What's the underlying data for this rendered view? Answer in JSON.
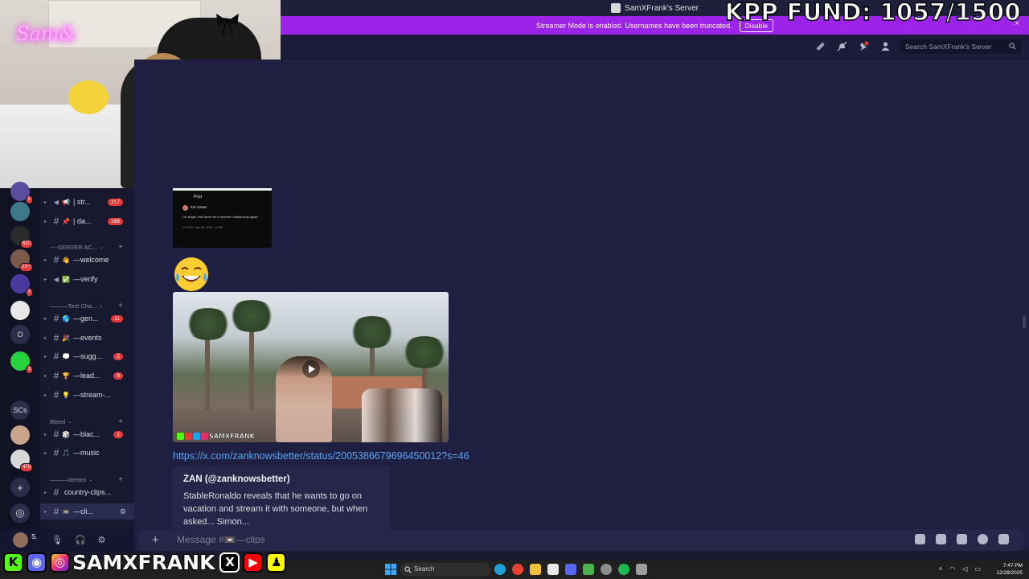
{
  "overlay": {
    "kpp_fund": "KPP FUND: 1057/1500",
    "cam_neon": "Sam&",
    "social_handle": "SAMXFRANK",
    "social_icons": [
      "kick-icon",
      "discord-icon",
      "instagram-icon",
      "x-icon",
      "youtube-icon",
      "snapchat-icon"
    ]
  },
  "window": {
    "title": "SamXFrank's Server",
    "close": "×"
  },
  "banner": {
    "text": "Streamer Mode is enabled. Usernames have been truncated.",
    "disable": "Disable"
  },
  "header": {
    "icons": [
      "threads-icon",
      "mute-icon",
      "pin-icon",
      "members-icon"
    ],
    "search_placeholder": "Search SamXFrank's Server"
  },
  "rail": {
    "servers": [
      {
        "label": "",
        "badge": "5"
      },
      {
        "label": "",
        "badge": ""
      },
      {
        "label": "",
        "badge": "610"
      },
      {
        "label": "",
        "badge": "1K+"
      },
      {
        "label": "",
        "badge": "1"
      },
      {
        "label": "",
        "badge": ""
      },
      {
        "label": "O",
        "badge": ""
      },
      {
        "label": "",
        "badge": "1"
      },
      {
        "label": "SCs",
        "badge": ""
      },
      {
        "label": "",
        "badge": ""
      },
      {
        "label": "",
        "badge": "479"
      }
    ]
  },
  "channels": {
    "items": [
      {
        "icon": "📢",
        "name": "| str...",
        "badge": "217",
        "type": "announce"
      },
      {
        "icon": "📌",
        "name": "| da...",
        "badge": "168",
        "type": "text"
      },
      {
        "cat": "----SERVER AC..."
      },
      {
        "icon": "👋",
        "name": "—welcome",
        "badge": "",
        "type": "text"
      },
      {
        "icon": "✅",
        "name": "—verify",
        "badge": "",
        "type": "announce"
      },
      {
        "cat": "———Text Cha..."
      },
      {
        "icon": "🌎",
        "name": "—gen...",
        "badge": "11",
        "type": "text"
      },
      {
        "icon": "🎉",
        "name": "—events",
        "badge": "",
        "type": "text"
      },
      {
        "icon": "💭",
        "name": "—sugg...",
        "badge": "2",
        "type": "text"
      },
      {
        "icon": "🏆",
        "name": "—lead...",
        "badge": "8",
        "type": "text"
      },
      {
        "icon": "💡",
        "name": "—stream-...",
        "badge": "",
        "type": "text"
      },
      {
        "cat": "Bleed"
      },
      {
        "icon": "🎲",
        "name": "—blac...",
        "badge": "1",
        "type": "text"
      },
      {
        "icon": "🎵",
        "name": "—music",
        "badge": "",
        "type": "text"
      },
      {
        "cat": "———stream"
      },
      {
        "icon": "",
        "name": "country-clips...",
        "badge": "",
        "type": "text"
      },
      {
        "icon": "📼",
        "name": "—cli...",
        "badge": "",
        "type": "text",
        "active": true
      }
    ]
  },
  "message": {
    "tweet_thumb": {
      "header": "Post",
      "name": "Kai Cenat",
      "text": "I'm single I will never be in another relationship again",
      "meta": "4:23 PM · Dec 28, 2025 · 12.9M"
    },
    "emoji": "joy-emoji",
    "video_watermark": "SAMXFRANK",
    "link": "https://x.com/zanknowsbetter/status/2005386679696450012?s=46",
    "embed_author": "ZAN (@zanknowsbetter)",
    "embed_desc": "StableRonaldo reveals that he wants to go on vacation and stream it with someone, but when asked... Simon... "
  },
  "composer": {
    "placeholder": "Message #📼—clips"
  },
  "user": {
    "name": "S.",
    "status": "I..."
  },
  "taskbar": {
    "search": "Search",
    "time": "7:47 PM",
    "date": "12/28/2025"
  },
  "colors": {
    "accent": "#9b24e8",
    "link": "#5aa4f5",
    "badge": "#e33b3b"
  }
}
